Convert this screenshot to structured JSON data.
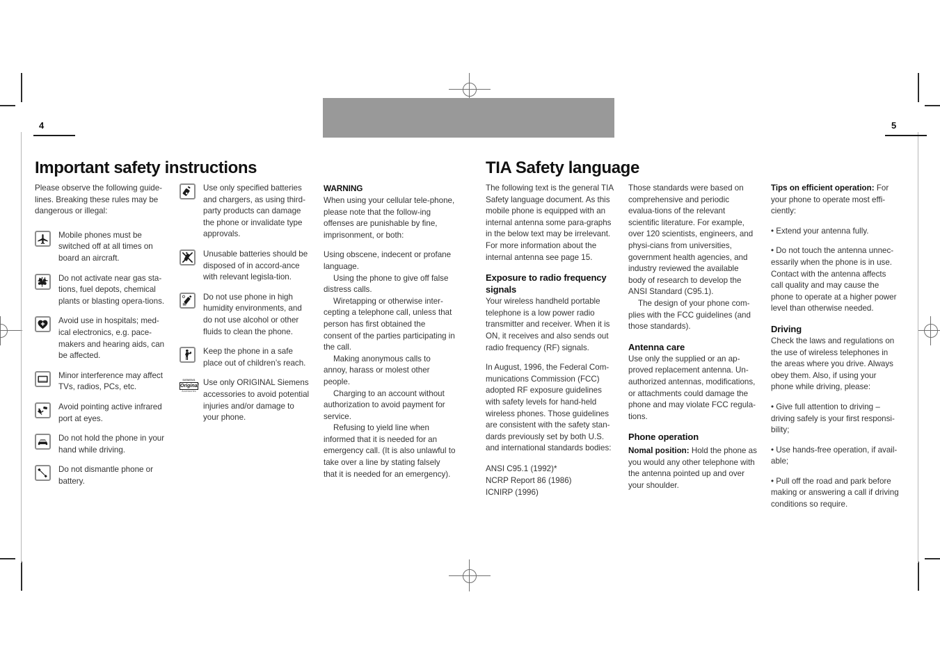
{
  "document": {
    "left_page_number": "4",
    "right_page_number": "5",
    "banner_color": "#999999"
  },
  "left_page": {
    "title": "Important safety instructions",
    "intro": "Please observe the following guide-lines. Breaking these rules may be dangerous or illegal:",
    "column_one_items": [
      {
        "icon": "airplane-icon",
        "text": "Mobile phones must be switched off at all times on board an aircraft."
      },
      {
        "icon": "gas-station-icon",
        "text": "Do not activate near gas sta-tions, fuel depots, chemical plants or blasting opera-tions."
      },
      {
        "icon": "hospital-heart-icon",
        "text": "Avoid use in hospitals; med-ical electronics, e.g. pace-makers and hearing aids, can be affected."
      },
      {
        "icon": "television-icon",
        "text": "Minor interference may affect TVs, radios, PCs, etc."
      },
      {
        "icon": "infrared-port-icon",
        "text": "Avoid pointing active infrared port at eyes."
      },
      {
        "icon": "car-driving-icon",
        "text": "Do not hold the phone in your hand while driving."
      },
      {
        "icon": "wrench-icon",
        "text": "Do not dismantle phone or battery."
      }
    ],
    "column_two_items": [
      {
        "icon": "battery-charger-icon",
        "text": "Use only specified batteries and chargers, as using third-party products can damage the phone or invalidate type approvals."
      },
      {
        "icon": "battery-disposal-icon",
        "text": "Unusable batteries should be disposed of in accord-ance with relevant legisla-tion."
      },
      {
        "icon": "no-liquids-icon",
        "text": "Do not use phone in high humidity environments, and do not use alcohol or other fluids to clean the phone."
      },
      {
        "icon": "keep-away-from-children-icon",
        "text": "Keep the phone in a safe place out of children’s reach."
      },
      {
        "icon": "siemens-original-accessories-icon",
        "icon_line1": "SIEMENS",
        "icon_line2": "Original",
        "icon_line3": "Accessories",
        "text": "Use only ORIGINAL Siemens accessories to avoid potential injuries and/or damage to your phone."
      }
    ],
    "warning_column": {
      "heading": "WARNING",
      "paragraph_1": "When using your cellular tele-phone, please note that the follow-ing offenses are punishable by fine, imprisonment, or both:",
      "paragraph_2": "Using obscene, indecent or profane language.",
      "paragraph_3": "Using the phone to give off false distress calls.",
      "paragraph_4": "Wiretapping or otherwise inter-cepting a telephone call, unless that person has first obtained the consent of the parties participating in the call.",
      "paragraph_5": "Making anonymous calls to annoy, harass or molest other people.",
      "paragraph_6": "Charging to an account without authorization to avoid payment for service.",
      "paragraph_7": "Refusing to yield line when informed that it is needed for an emergency call.  (It is also unlawful to take over a line by stating falsely that it is needed for an emergency)."
    }
  },
  "right_page": {
    "title": "TIA Safety language",
    "column_one": {
      "intro": "The following text is the general TIA Safety language document. As this mobile phone is equipped with an internal antenna some para-graphs in the below text may be irrelevant. For more information about the internal antenna see page 15.",
      "heading_exposure": "Exposure to radio frequency signals",
      "exposure_p1": "Your wireless handheld portable telephone is a low power radio transmitter and receiver.  When it is ON, it receives and also sends out radio frequency (RF) signals.",
      "exposure_p2": "In August, 1996, the Federal Com-munications Commission (FCC) adopted RF exposure guidelines with safety levels for hand-held wireless phones.  Those guidelines are consistent with the safety stan-dards previously set by both U.S. and international standards bodies:",
      "standards": [
        "ANSI C95.1 (1992)*",
        "NCRP Report 86 (1986)",
        "ICNIRP (1996)"
      ]
    },
    "column_two": {
      "p1": "Those standards were based on comprehensive and periodic evalua-tions of the relevant scientific literature.  For example, over 120 scientists, engineers, and physi-cians from universities, government health agencies, and industry reviewed the available body of research to develop the ANSI Standard (C95.1).",
      "p2": "The design of your phone com-plies with the FCC guidelines (and those standards).",
      "heading_antenna": "Antenna care",
      "antenna_p1": "Use only the supplied or an ap-proved replacement antenna.  Un-authorized antennas, modifications, or attachments could damage the phone and may violate FCC regula-tions.",
      "heading_phone_operation": "Phone operation",
      "normal_position_label": "Nomal position:",
      "normal_position_text": "  Hold the phone as you would any other telephone with the antenna pointed up and over your shoulder."
    },
    "column_three": {
      "tips_label": "Tips on efficient operation:",
      "tips_text": " For your phone to operate most effi-ciently:",
      "bullet_1": "• Extend your antenna fully.",
      "bullet_2": "• Do not touch the antenna unnec-essarily when the phone is in use. Contact with the antenna affects call quality and may cause the phone to operate at a higher power level than otherwise needed.",
      "heading_driving": "Driving",
      "driving_p1": "Check the laws and regulations on the use of wireless telephones in the areas where you drive.  Always obey them.  Also, if using your phone while driving, please:",
      "driving_bullet_1": "• Give full attention to driving – driving safely is your first responsi-bility;",
      "driving_bullet_2": "• Use hands-free operation, if avail-able;",
      "driving_bullet_3": "• Pull off the road and park before making or answering a call if driving conditions so require."
    }
  }
}
